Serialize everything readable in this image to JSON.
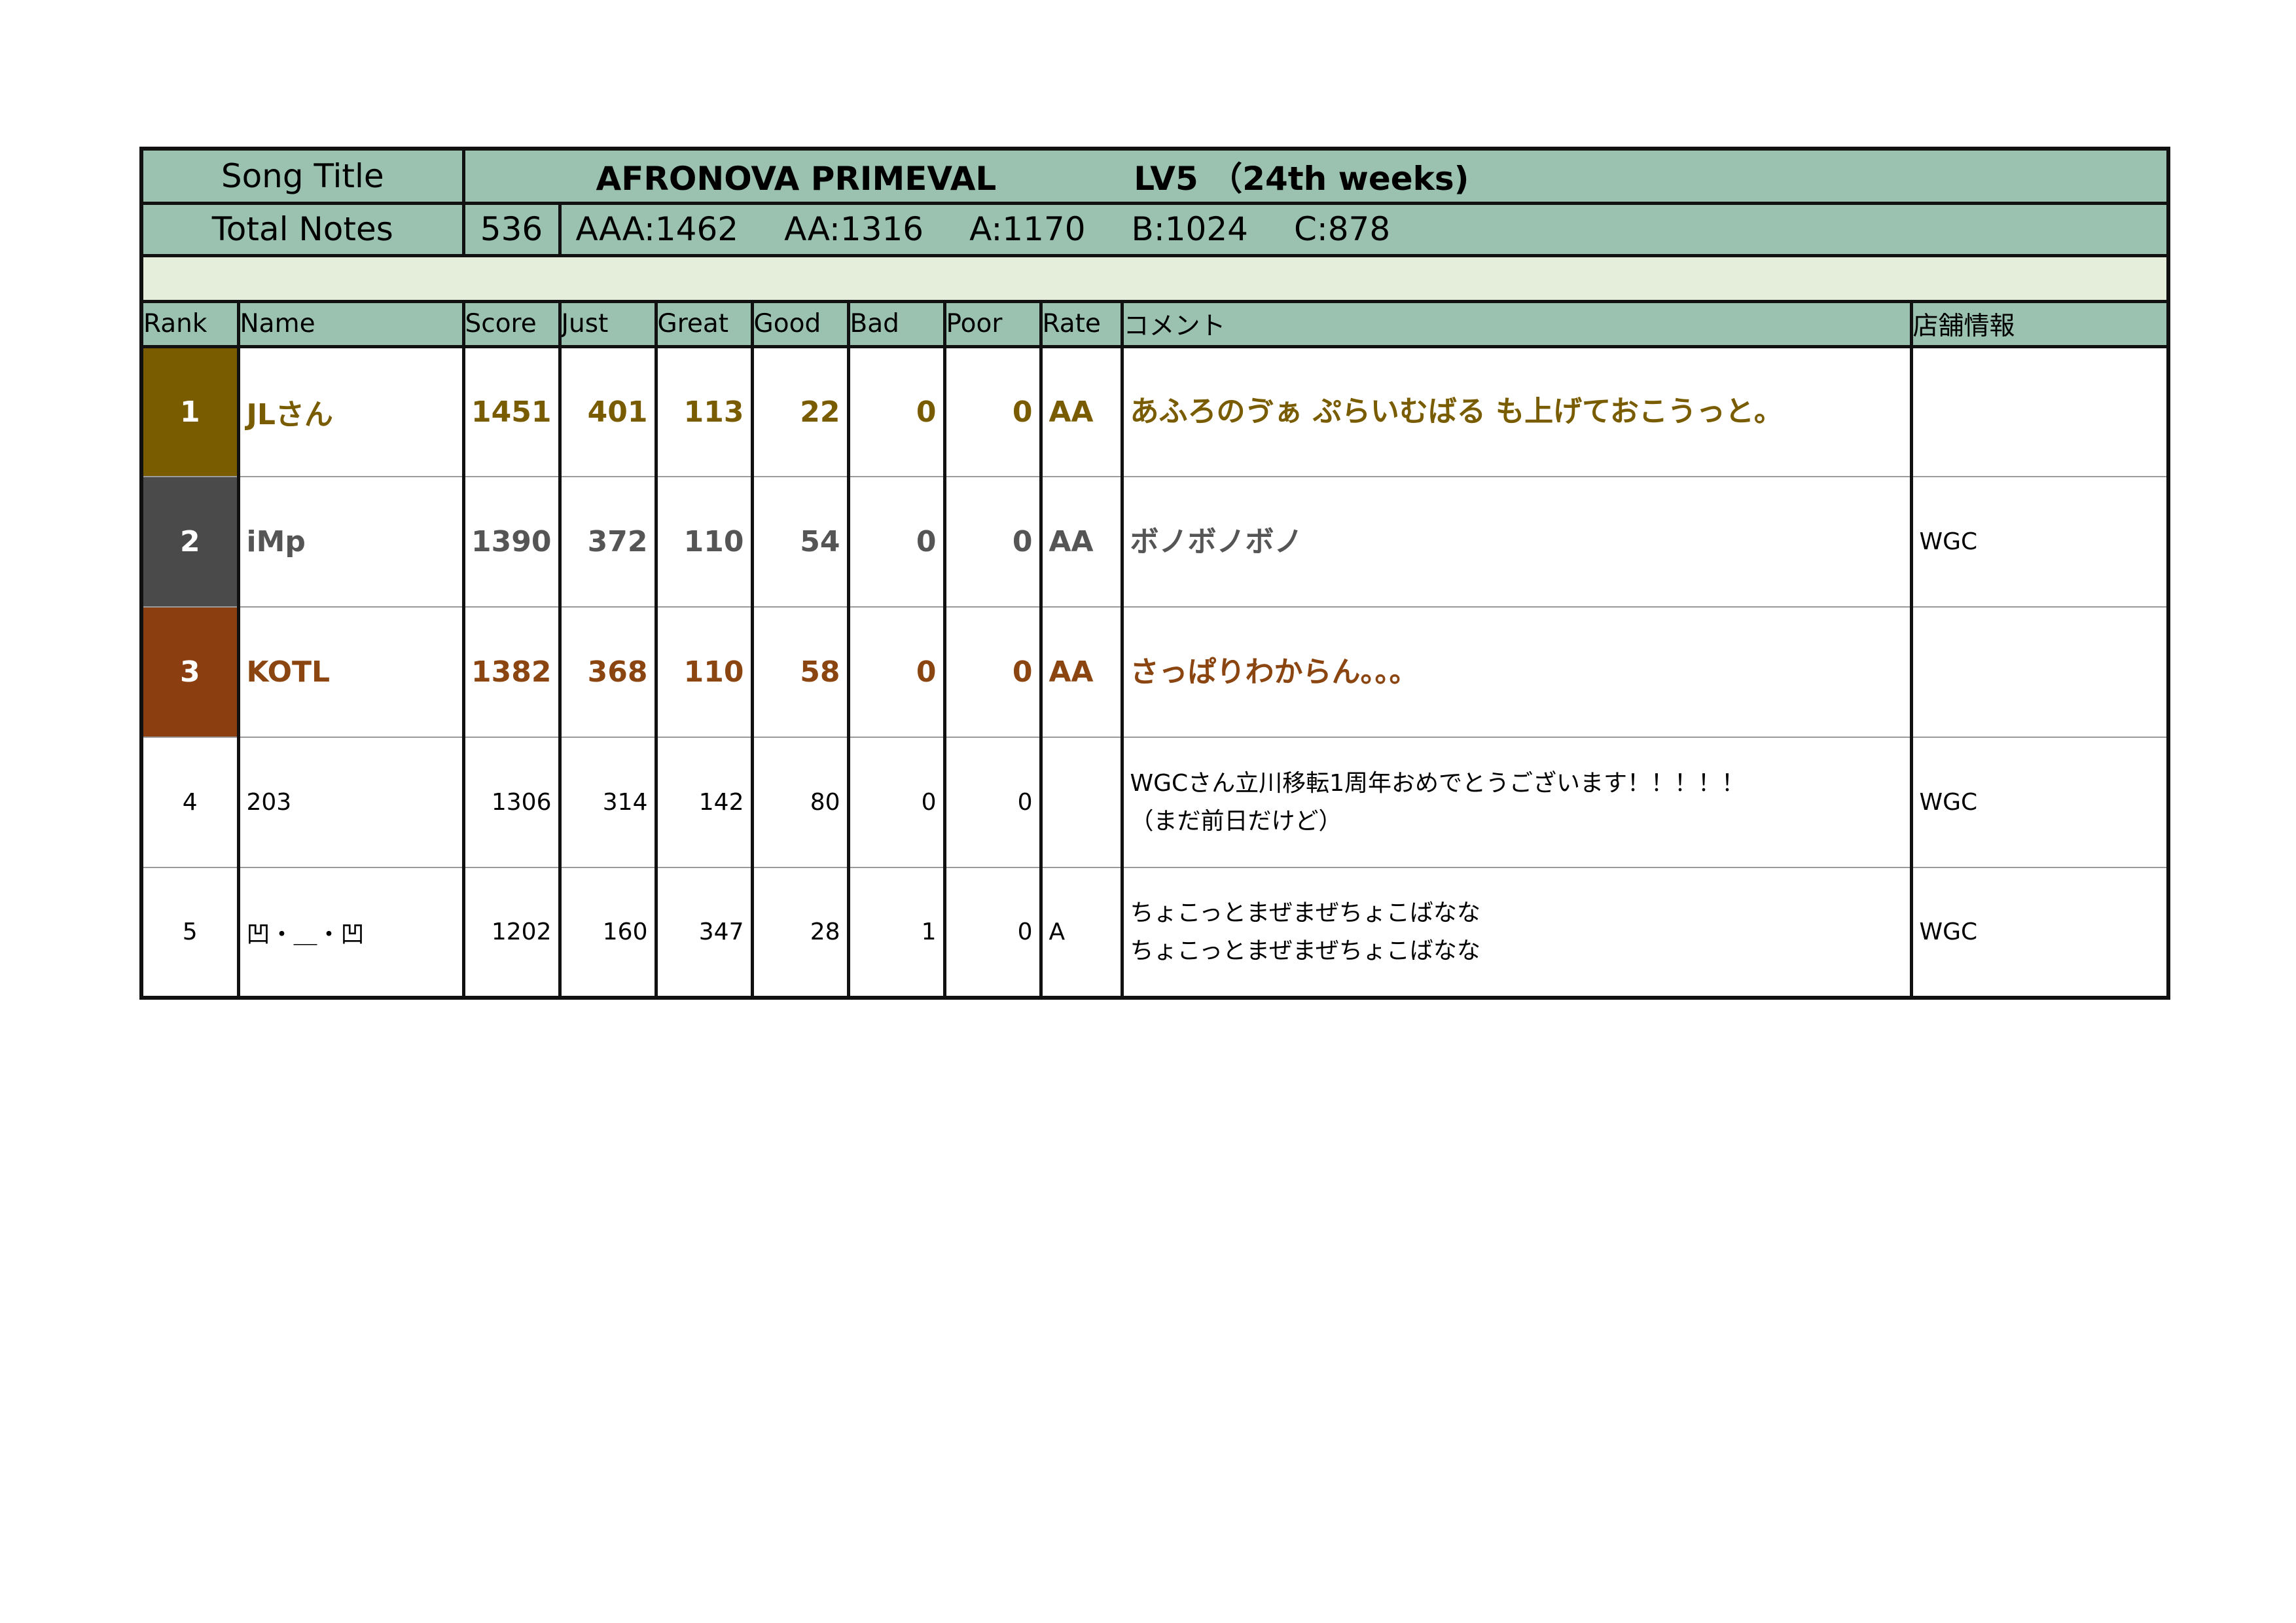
{
  "song": {
    "title_label": "Song Title",
    "title": "AFRONOVA PRIMEVAL",
    "level": "LV5 （24th weeks)"
  },
  "notes": {
    "label": "Total Notes",
    "total": "536",
    "aaa": "AAA:1462",
    "aa": "AA:1316",
    "a": "A:1170",
    "b": "B:1024",
    "c": "C:878"
  },
  "columns": [
    "Rank",
    "Name",
    "Score",
    "Just",
    "Great",
    "Good",
    "Bad",
    "Poor",
    "Rate",
    "コメント",
    "店舗情報"
  ],
  "rows": [
    {
      "rank": "1",
      "name": "JLさん",
      "score": "1451",
      "just": "401",
      "great": "113",
      "good": "22",
      "bad": "0",
      "poor": "0",
      "rate": "AA",
      "comment": [
        "あふろのゔぁ ぷらいむばる も上げておこうっと。"
      ],
      "shop": ""
    },
    {
      "rank": "2",
      "name": "iMp",
      "score": "1390",
      "just": "372",
      "great": "110",
      "good": "54",
      "bad": "0",
      "poor": "0",
      "rate": "AA",
      "comment": [
        "ボノボノボノ"
      ],
      "shop": "WGC"
    },
    {
      "rank": "3",
      "name": "KOTL",
      "score": "1382",
      "just": "368",
      "great": "110",
      "good": "58",
      "bad": "0",
      "poor": "0",
      "rate": "AA",
      "comment": [
        "さっぱりわからん。。。"
      ],
      "shop": ""
    },
    {
      "rank": "4",
      "name": "203",
      "score": "1306",
      "just": "314",
      "great": "142",
      "good": "80",
      "bad": "0",
      "poor": "0",
      "rate": "",
      "comment": [
        "WGCさん立川移転1周年おめでとうございます！！！！！",
        "（まだ前日だけど）"
      ],
      "shop": "WGC"
    },
    {
      "rank": "5",
      "name": "凹・＿・凹",
      "score": "1202",
      "just": "160",
      "great": "347",
      "good": "28",
      "bad": "1",
      "poor": "0",
      "rate": "A",
      "comment": [
        "ちょこっとまぜまぜちょこばなな",
        "ちょこっとまぜまぜちょこばなな"
      ],
      "shop": "WGC"
    }
  ]
}
